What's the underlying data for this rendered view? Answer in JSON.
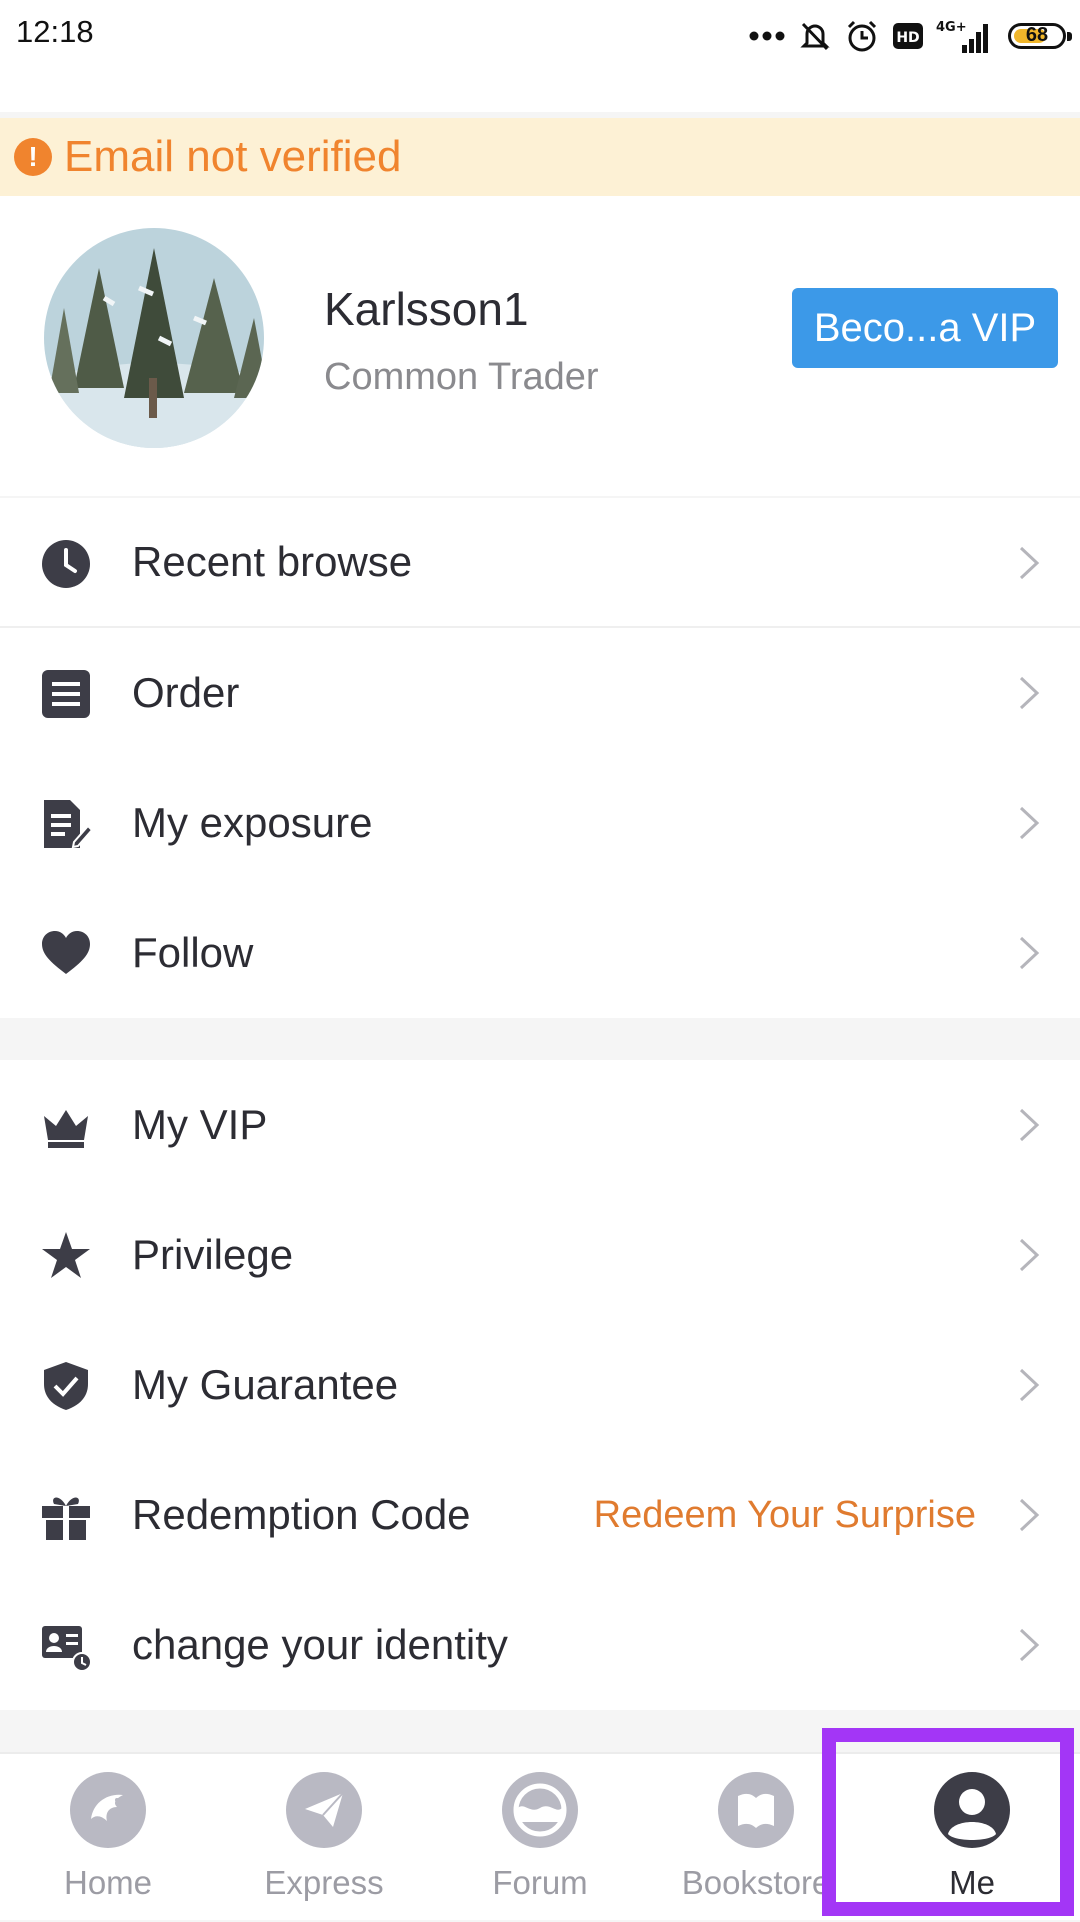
{
  "status_bar": {
    "time": "12:18",
    "network": "4G+",
    "hd": "HD",
    "battery": "68"
  },
  "banner": {
    "icon": "alert-circle-icon",
    "text": "Email not verified",
    "color": "#f0842e"
  },
  "profile": {
    "username": "Karlsson1",
    "role": "Common Trader",
    "vip_button_label": "Beco...a VIP",
    "vip_button_color": "#3c99e8",
    "avatar_icon": "avatar-photo-snowy-forest"
  },
  "menu_group_1": [
    {
      "icon": "clock-icon",
      "label": "Recent browse"
    },
    {
      "icon": "order-list-icon",
      "label": "Order"
    },
    {
      "icon": "document-edit-icon",
      "label": "My exposure"
    },
    {
      "icon": "heart-icon",
      "label": "Follow"
    }
  ],
  "menu_group_2": [
    {
      "icon": "crown-icon",
      "label": "My VIP"
    },
    {
      "icon": "star-icon",
      "label": "Privilege"
    },
    {
      "icon": "shield-check-icon",
      "label": "My Guarantee"
    },
    {
      "icon": "gift-icon",
      "label": "Redemption Code",
      "extra": "Redeem Your Surprise"
    },
    {
      "icon": "id-card-icon",
      "label": "change your identity"
    }
  ],
  "bottom_nav": [
    {
      "icon": "eagle-icon",
      "label": "Home",
      "active": false
    },
    {
      "icon": "paper-plane-icon",
      "label": "Express",
      "active": false
    },
    {
      "icon": "wave-icon",
      "label": "Forum",
      "active": false
    },
    {
      "icon": "book-icon",
      "label": "Bookstore",
      "active": false
    },
    {
      "icon": "user-icon",
      "label": "Me",
      "active": true
    }
  ],
  "highlight_color": "#a336f6"
}
